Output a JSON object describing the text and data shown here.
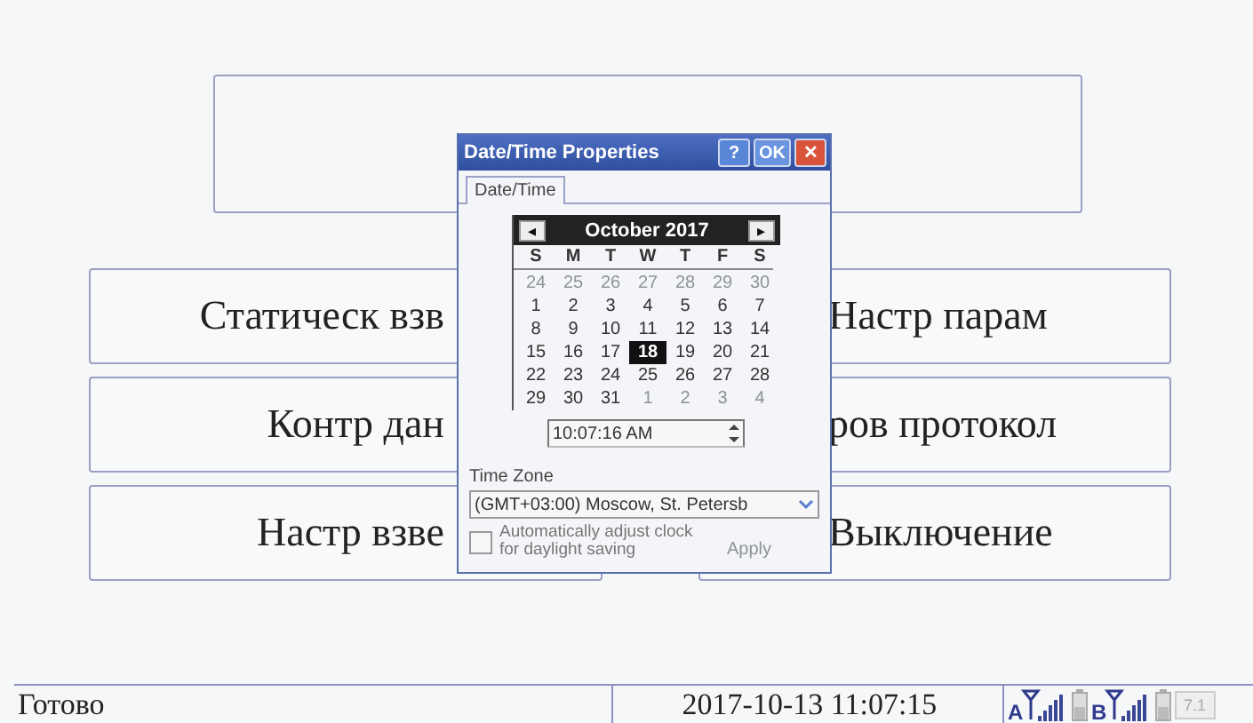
{
  "main_buttons": [
    {
      "label": "Статическ взв"
    },
    {
      "label": "Настр парам"
    },
    {
      "label": "Контр дан"
    },
    {
      "label": "ров протокол"
    },
    {
      "label": "Настр взве"
    },
    {
      "label": "Выключение"
    }
  ],
  "dialog": {
    "title": "Date/Time Properties",
    "title_buttons": [
      {
        "kind": "help",
        "label": "?"
      },
      {
        "kind": "ok",
        "label": "OK"
      },
      {
        "kind": "close",
        "label": "✕"
      }
    ],
    "tabs": [
      {
        "label": "Date/Time",
        "selected": true
      }
    ],
    "calendar": {
      "prev": "◂",
      "next": "▸",
      "month": "October 2017",
      "weekdays": [
        "S",
        "M",
        "T",
        "W",
        "T",
        "F",
        "S"
      ],
      "weeks": [
        [
          {
            "day": "24",
            "muted": true,
            "selected": false
          },
          {
            "day": "25",
            "muted": true,
            "selected": false
          },
          {
            "day": "26",
            "muted": true,
            "selected": false
          },
          {
            "day": "27",
            "muted": true,
            "selected": false
          },
          {
            "day": "28",
            "muted": true,
            "selected": false
          },
          {
            "day": "29",
            "muted": true,
            "selected": false
          },
          {
            "day": "30",
            "muted": true,
            "selected": false
          }
        ],
        [
          {
            "day": "1",
            "muted": false,
            "selected": false
          },
          {
            "day": "2",
            "muted": false,
            "selected": false
          },
          {
            "day": "3",
            "muted": false,
            "selected": false
          },
          {
            "day": "4",
            "muted": false,
            "selected": false
          },
          {
            "day": "5",
            "muted": false,
            "selected": false
          },
          {
            "day": "6",
            "muted": false,
            "selected": false
          },
          {
            "day": "7",
            "muted": false,
            "selected": false
          }
        ],
        [
          {
            "day": "8",
            "muted": false,
            "selected": false
          },
          {
            "day": "9",
            "muted": false,
            "selected": false
          },
          {
            "day": "10",
            "muted": false,
            "selected": false
          },
          {
            "day": "11",
            "muted": false,
            "selected": false
          },
          {
            "day": "12",
            "muted": false,
            "selected": false
          },
          {
            "day": "13",
            "muted": false,
            "selected": false
          },
          {
            "day": "14",
            "muted": false,
            "selected": false
          }
        ],
        [
          {
            "day": "15",
            "muted": false,
            "selected": false
          },
          {
            "day": "16",
            "muted": false,
            "selected": false
          },
          {
            "day": "17",
            "muted": false,
            "selected": false
          },
          {
            "day": "18",
            "muted": false,
            "selected": true
          },
          {
            "day": "19",
            "muted": false,
            "selected": false
          },
          {
            "day": "20",
            "muted": false,
            "selected": false
          },
          {
            "day": "21",
            "muted": false,
            "selected": false
          }
        ],
        [
          {
            "day": "22",
            "muted": false,
            "selected": false
          },
          {
            "day": "23",
            "muted": false,
            "selected": false
          },
          {
            "day": "24",
            "muted": false,
            "selected": false
          },
          {
            "day": "25",
            "muted": false,
            "selected": false
          },
          {
            "day": "26",
            "muted": false,
            "selected": false
          },
          {
            "day": "27",
            "muted": false,
            "selected": false
          },
          {
            "day": "28",
            "muted": false,
            "selected": false
          }
        ],
        [
          {
            "day": "29",
            "muted": false,
            "selected": false
          },
          {
            "day": "30",
            "muted": false,
            "selected": false
          },
          {
            "day": "31",
            "muted": false,
            "selected": false
          },
          {
            "day": "1",
            "muted": true,
            "selected": false
          },
          {
            "day": "2",
            "muted": true,
            "selected": false
          },
          {
            "day": "3",
            "muted": true,
            "selected": false
          },
          {
            "day": "4",
            "muted": true,
            "selected": false
          }
        ]
      ]
    },
    "time": "10:07:16 AM",
    "time_zone_label": "Time Zone",
    "time_zone": "(GMT+03:00) Moscow, St. Petersb",
    "dst": {
      "label": "Automatically adjust clock for daylight saving",
      "checked": false
    },
    "apply": {
      "label": "Apply",
      "disabled": true
    }
  },
  "status_bar": {
    "status": "Готово",
    "datetime": "2017-10-13 11:07:15",
    "modem_a": "A",
    "modem_b": "B",
    "version": "7.1"
  }
}
